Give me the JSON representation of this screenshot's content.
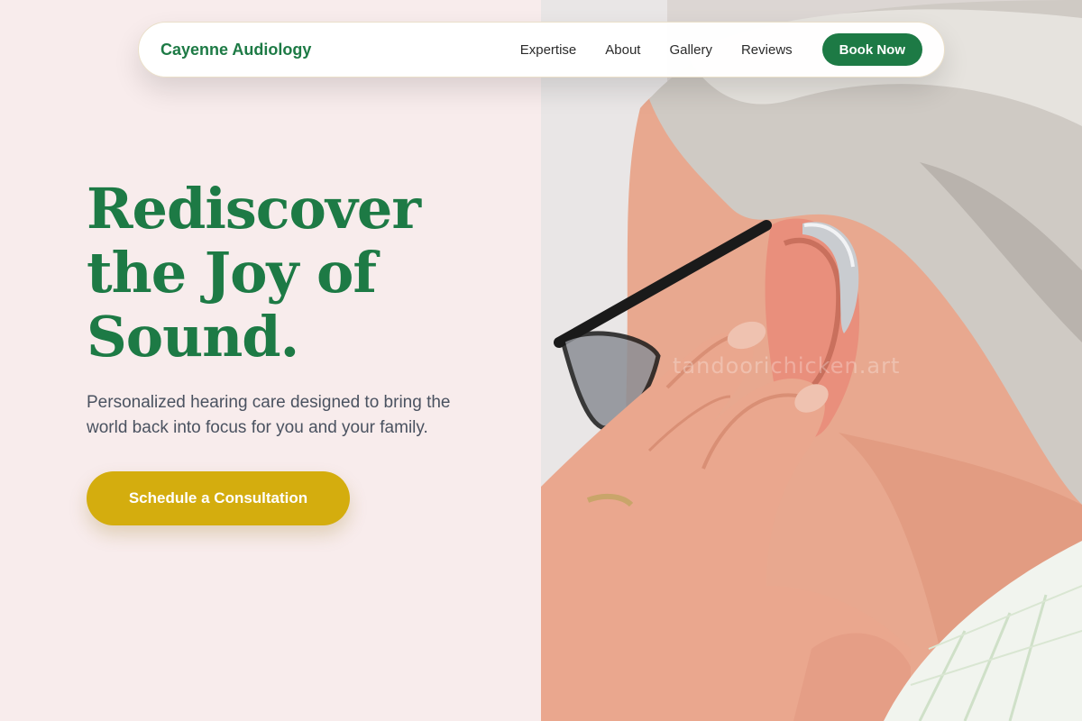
{
  "nav": {
    "brand": "Cayenne Audiology",
    "links": [
      "Expertise",
      "About",
      "Gallery",
      "Reviews"
    ],
    "cta_label": "Book Now"
  },
  "hero": {
    "headline_lines": [
      "Rediscover",
      "the Joy of",
      "Sound."
    ],
    "subtext": "Personalized hearing care designed to bring the world back into focus for you and your family.",
    "cta_label": "Schedule a Consultation"
  },
  "photo": {
    "watermark": "tandoorichicken.art"
  },
  "colors": {
    "page_bg": "#f8ecec",
    "brand_green": "#1d7a45",
    "cta_gold": "#d4ad0e",
    "body_text": "#4a5260"
  }
}
